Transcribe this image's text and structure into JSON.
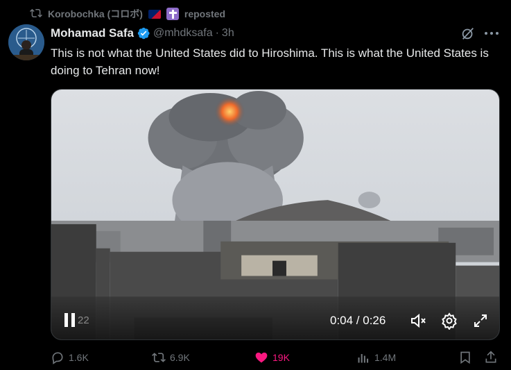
{
  "repost": {
    "user": "Korobochka (コロボ)",
    "label": "reposted",
    "emoji_icons": [
      "australia-flag-icon",
      "cross-icon"
    ]
  },
  "author": {
    "name": "Mohamad Safa",
    "handle": "@mhdksafa",
    "separator": "·",
    "time": "3h"
  },
  "tweet": {
    "text": "This is not what the United States did to Hiroshima. This is what the United States is doing to Tehran now!"
  },
  "video": {
    "timecode": "0:04 / 0:26",
    "ghost_time": "22"
  },
  "actions": {
    "replies": "1.6K",
    "reposts": "6.9K",
    "likes": "19K",
    "views": "1.4M"
  },
  "colors": {
    "background": "#000000",
    "secondary_text": "#71767b",
    "verified": "#1d9bf0",
    "like": "#f91880"
  }
}
